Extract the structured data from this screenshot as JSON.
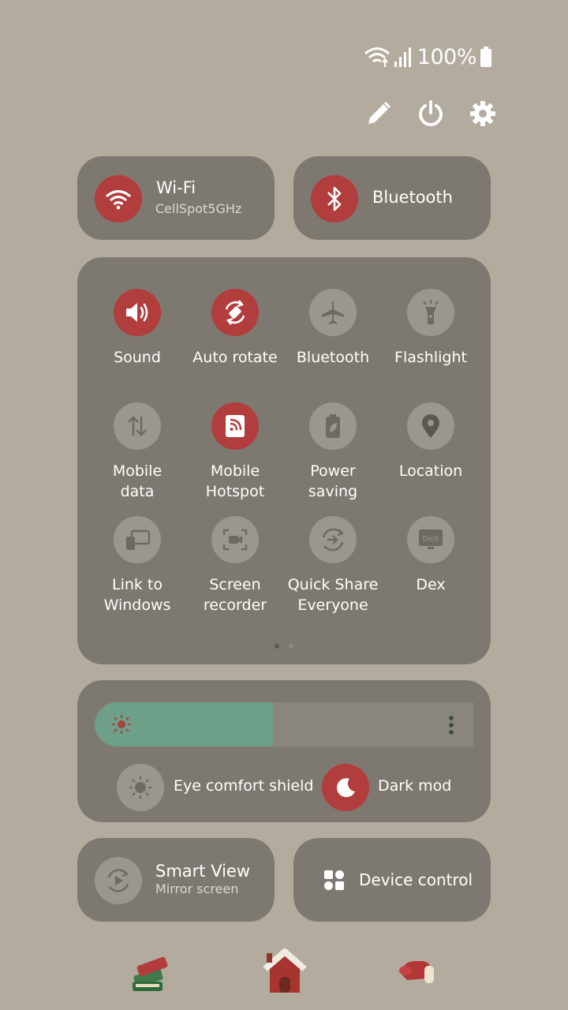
{
  "status_bar": {
    "battery": "100%",
    "icons": [
      "wifi-icon",
      "signal-icon",
      "battery-icon"
    ]
  },
  "top_actions": [
    "pencil-icon",
    "power-icon",
    "gear-icon"
  ],
  "wide_tiles": {
    "wifi": {
      "title": "Wi-Fi",
      "subtitle": "CellSpot5GHz",
      "state": "on"
    },
    "bluetooth": {
      "title": "Bluetooth",
      "state": "on"
    }
  },
  "tiles": [
    {
      "label": "Sound",
      "icon": "sound-icon",
      "state": "on"
    },
    {
      "label": "Auto rotate",
      "icon": "auto-rotate-icon",
      "state": "on"
    },
    {
      "label": "Bluetooth",
      "icon": "airplane-icon",
      "state": "off"
    },
    {
      "label": "Flashlight",
      "icon": "flashlight-icon",
      "state": "off"
    },
    {
      "label": "Mobile\ndata",
      "icon": "mobile-data-icon",
      "state": "off"
    },
    {
      "label": "Mobile\nHotspot",
      "icon": "hotspot-icon",
      "state": "on"
    },
    {
      "label": "Power saving",
      "icon": "power-saving-icon",
      "state": "off"
    },
    {
      "label": "Location",
      "icon": "location-icon",
      "state": "off"
    },
    {
      "label": "Link to\nWindows",
      "icon": "link-to-windows-icon",
      "state": "off"
    },
    {
      "label": "Screen\nrecorder",
      "icon": "screen-recorder-icon",
      "state": "off"
    },
    {
      "label": "Quick Share\nEveryone",
      "icon": "quick-share-icon",
      "state": "off"
    },
    {
      "label": "Dex",
      "icon": "dex-icon",
      "state": "off"
    }
  ],
  "page_indicator": {
    "current": 1,
    "total": 2
  },
  "brightness": {
    "level": 0.47
  },
  "display_toggles": {
    "eye_comfort": {
      "label": "Eye comfort shield",
      "state": "off"
    },
    "dark_mode": {
      "label": "Dark mode",
      "state": "on"
    }
  },
  "bottom_tiles": {
    "smart_view": {
      "title": "Smart View",
      "subtitle": "Mirror screen"
    },
    "device_control": {
      "title": "Device control"
    }
  },
  "dock": [
    "books-icon",
    "house-icon",
    "mitten-icon"
  ],
  "colors": {
    "accent": "#b13d3d",
    "panel": "#7e7970",
    "background": "#b2ab9e",
    "brightness_fill": "#6e9f89"
  }
}
